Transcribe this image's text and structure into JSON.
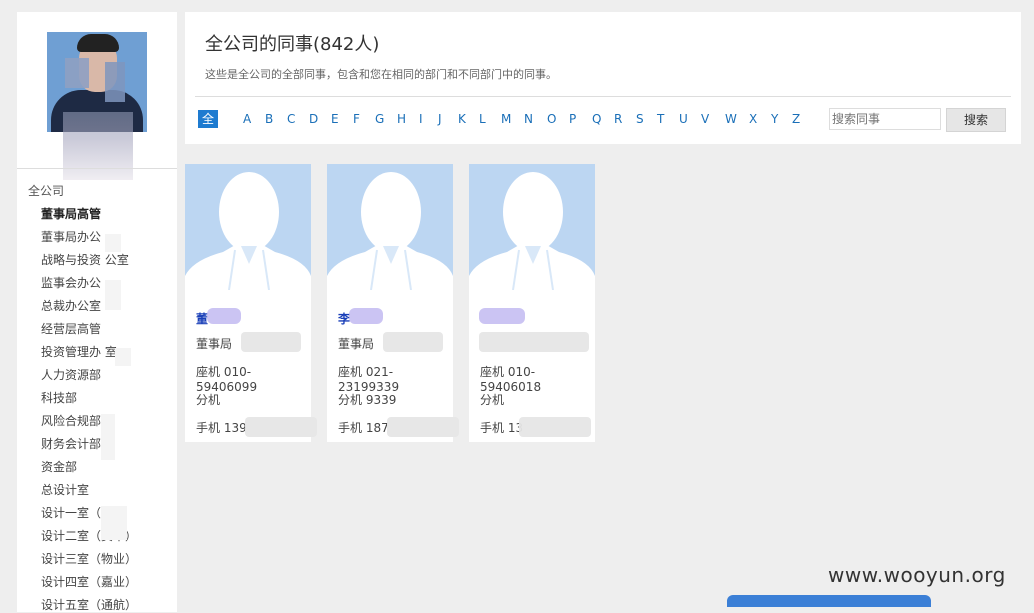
{
  "sidebar": {
    "root_label": "全公司",
    "items": [
      {
        "label": "董事局高管",
        "active": true
      },
      {
        "label": "董事局办公"
      },
      {
        "label": "战略与投资 公室"
      },
      {
        "label": "监事会办公"
      },
      {
        "label": "总裁办公室"
      },
      {
        "label": "经营层高管"
      },
      {
        "label": "投资管理办 室"
      },
      {
        "label": "人力资源部"
      },
      {
        "label": "科技部"
      },
      {
        "label": "风险合规部"
      },
      {
        "label": "财务会计部"
      },
      {
        "label": "资金部"
      },
      {
        "label": "总设计室"
      },
      {
        "label": "设计一室（ 二）"
      },
      {
        "label": "设计二室（资本）"
      },
      {
        "label": "设计三室（物业）"
      },
      {
        "label": "设计四室（嘉业）"
      },
      {
        "label": "设计五室（通航）"
      }
    ]
  },
  "header": {
    "title": "全公司的同事(842人)",
    "subtitle": "这些是全公司的全部同事，包含和您在相同的部门和不同部门中的同事。",
    "letters": [
      "全部",
      "A",
      "B",
      "C",
      "D",
      "E",
      "F",
      "G",
      "H",
      "I",
      "J",
      "K",
      "L",
      "M",
      "N",
      "O",
      "P",
      "Q",
      "R",
      "S",
      "T",
      "U",
      "V",
      "W",
      "X",
      "Y",
      "Z"
    ],
    "search_placeholder": "搜索同事",
    "search_button": "搜索"
  },
  "cards": [
    {
      "name": "董",
      "dept": "董事局",
      "phone": "座机 010-59406099",
      "ext": "分机",
      "mobile": "手机 139"
    },
    {
      "name": "李",
      "dept": "董事局",
      "phone": "座机 021-23199339",
      "ext": "分机 9339",
      "mobile": "手机 187"
    },
    {
      "name": "",
      "dept": "",
      "phone": "座机 010-59406018",
      "ext": "分机",
      "mobile": "手机 13"
    }
  ],
  "watermark": "www.wooyun.org",
  "colors": {
    "accent": "#1e7bd0",
    "link": "#1a6fb8",
    "photo_bg": "#bcd6f2"
  }
}
